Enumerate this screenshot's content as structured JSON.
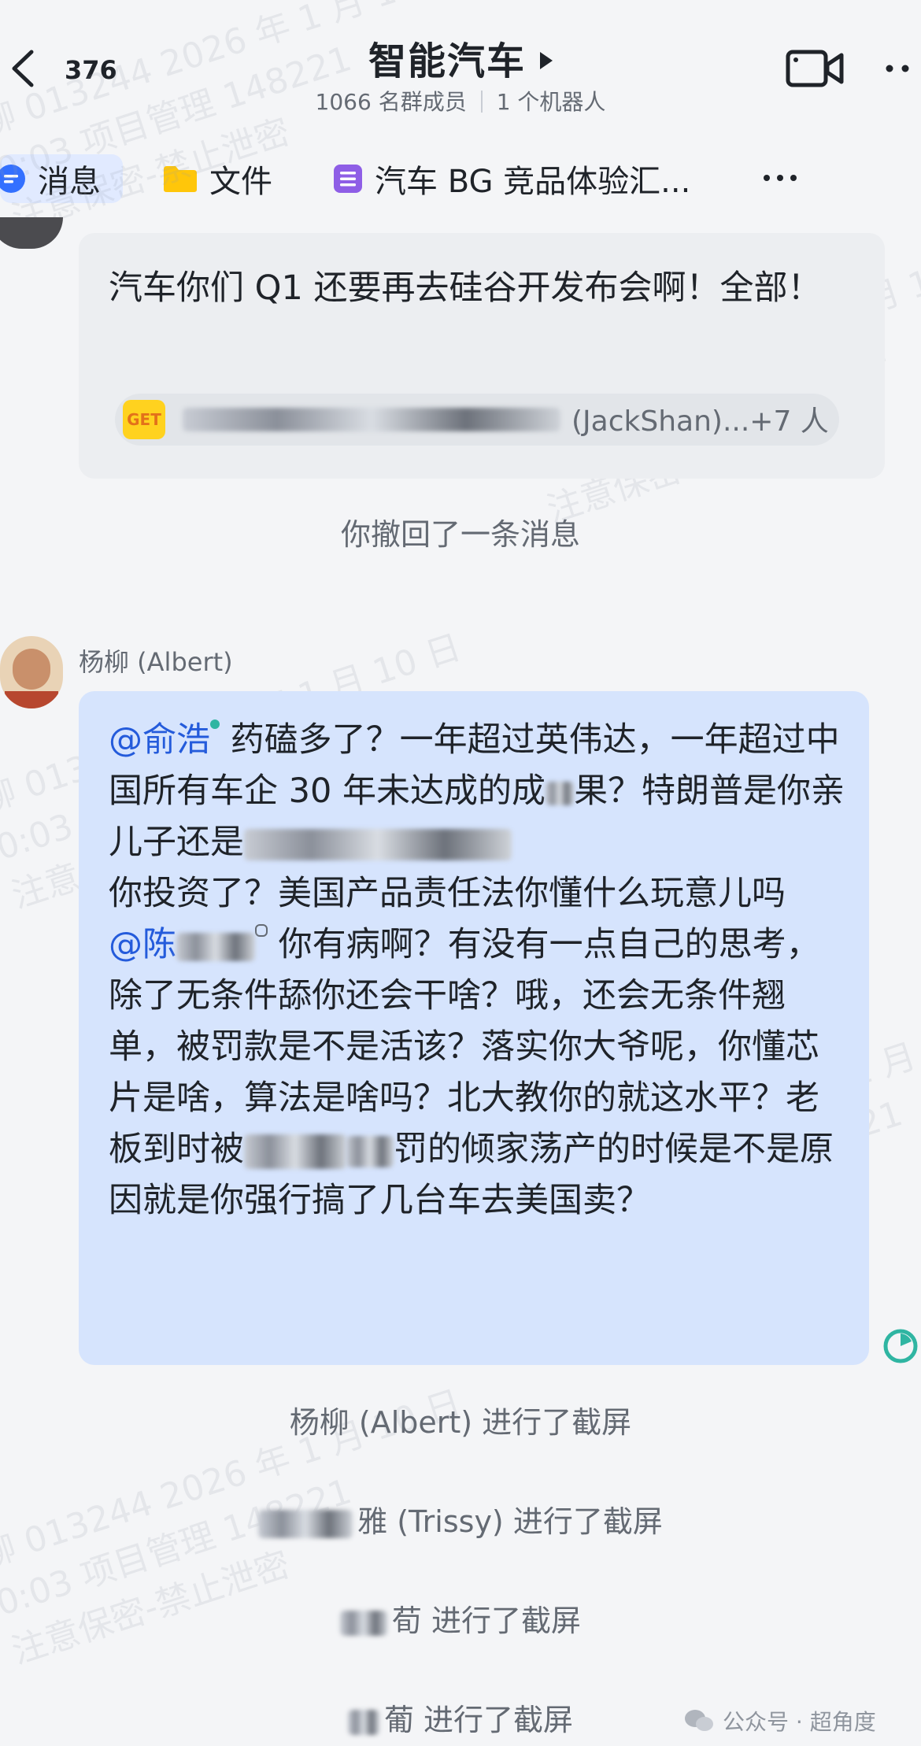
{
  "header": {
    "back_count": "376",
    "title": "智能汽车",
    "members": "1066 名群成员",
    "bots": "1 个机器人"
  },
  "tabs": {
    "messages": "消息",
    "files": "文件",
    "doc": "汽车 BG 竞品体验汇..."
  },
  "messages": {
    "first": {
      "text": "汽车你们 Q1 还要再去硅谷开发布会啊！全部！",
      "reactions_suffix": "(JackShan)...+7 人",
      "reaction_sticker": "GET"
    },
    "recalled": "你撤回了一条消息",
    "albert": {
      "sender": "杨柳 (Albert)",
      "mention1": "@俞浩",
      "line1": " 药磕多了？一年超过英伟达，一年超过中国所有车企 30 年未达成的成",
      "line2": "果？特朗普是你亲儿子还是",
      "line3": "你投资了？美国产品责任法你懂什么玩意儿吗",
      "mention2": "@陈",
      "line4": " 你有病啊？有没有一点自己的思考，除了无条件舔你还会干啥？哦，还会无条件翘单，被罚款是不是活该？落实你大爷呢，你懂芯片是啥，算法是啥吗？北大教你的就这水平？老板到时被",
      "line5": "罚的倾家荡产的时候是不是原因就是你强行搞了几台车去美国卖？"
    }
  },
  "system_events": [
    "杨柳 (Albert) 进行了截屏",
    "雅 (Trissy) 进行了截屏",
    "荀 进行了截屏",
    "葡 进行了截屏"
  ],
  "watermark": {
    "line1": "柳 013244 2026 年 1 月 10 日",
    "line2": "0:03 项目管理 148221",
    "line3": "注意保密-禁止泄密"
  },
  "footer": {
    "source": "公众号 · 超角度"
  },
  "colors": {
    "accent": "#245bdb",
    "bubble_blue": "#d6e4fd",
    "bubble_gray": "#eceef1"
  }
}
